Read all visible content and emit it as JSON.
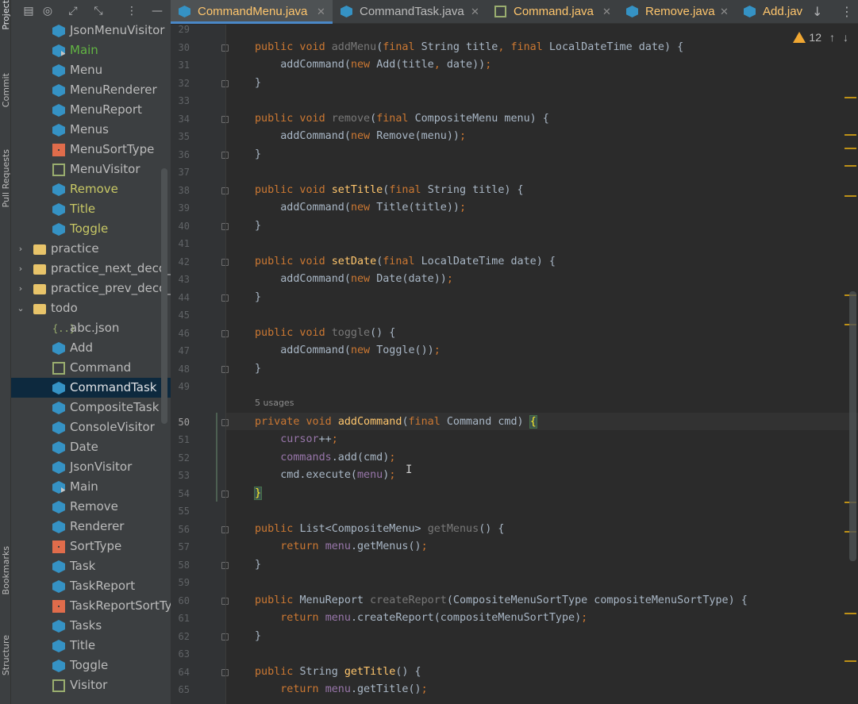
{
  "side_strip": {
    "project": "Project",
    "commit": "Commit",
    "pull_requests": "Pull Requests",
    "bookmarks": "Bookmarks",
    "structure": "Structure"
  },
  "tree": [
    {
      "label": "JsonMenuVisitor",
      "icon": "class-icon",
      "style": ""
    },
    {
      "label": "Main",
      "icon": "run-class-icon",
      "style": "green"
    },
    {
      "label": "Menu",
      "icon": "class-icon",
      "style": ""
    },
    {
      "label": "MenuRenderer",
      "icon": "class-icon",
      "style": ""
    },
    {
      "label": "MenuReport",
      "icon": "class-icon",
      "style": ""
    },
    {
      "label": "Menus",
      "icon": "class-icon",
      "style": ""
    },
    {
      "label": "MenuSortType",
      "icon": "enum-icon",
      "style": ""
    },
    {
      "label": "MenuVisitor",
      "icon": "interface-icon",
      "style": ""
    },
    {
      "label": "Remove",
      "icon": "class-icon",
      "style": "green2"
    },
    {
      "label": "Title",
      "icon": "class-icon",
      "style": "green2"
    },
    {
      "label": "Toggle",
      "icon": "class-icon",
      "style": "green2"
    },
    {
      "label": "practice",
      "icon": "folder-icon",
      "style": "",
      "chev": "›",
      "indent": 1
    },
    {
      "label": "practice_next_deco_fo",
      "icon": "folder-icon",
      "style": "",
      "chev": "›",
      "indent": 1
    },
    {
      "label": "practice_prev_deco_fo",
      "icon": "folder-icon",
      "style": "",
      "chev": "›",
      "indent": 1
    },
    {
      "label": "todo",
      "icon": "folder-icon",
      "style": "",
      "chev": "⌄",
      "indent": 1
    },
    {
      "label": "abc.json",
      "icon": "json-icon",
      "style": ""
    },
    {
      "label": "Add",
      "icon": "class-icon",
      "style": ""
    },
    {
      "label": "Command",
      "icon": "interface-icon",
      "style": ""
    },
    {
      "label": "CommandTask",
      "icon": "class-icon",
      "style": "selected"
    },
    {
      "label": "CompositeTask",
      "icon": "class-icon",
      "style": ""
    },
    {
      "label": "ConsoleVisitor",
      "icon": "class-icon",
      "style": ""
    },
    {
      "label": "Date",
      "icon": "class-icon",
      "style": ""
    },
    {
      "label": "JsonVisitor",
      "icon": "class-icon",
      "style": ""
    },
    {
      "label": "Main",
      "icon": "run-class-icon",
      "style": ""
    },
    {
      "label": "Remove",
      "icon": "class-icon",
      "style": ""
    },
    {
      "label": "Renderer",
      "icon": "class-icon",
      "style": ""
    },
    {
      "label": "SortType",
      "icon": "enum-icon",
      "style": ""
    },
    {
      "label": "Task",
      "icon": "class-icon",
      "style": ""
    },
    {
      "label": "TaskReport",
      "icon": "class-icon",
      "style": ""
    },
    {
      "label": "TaskReportSortTyp",
      "icon": "enum-icon",
      "style": ""
    },
    {
      "label": "Tasks",
      "icon": "class-icon",
      "style": ""
    },
    {
      "label": "Title",
      "icon": "class-icon",
      "style": ""
    },
    {
      "label": "Toggle",
      "icon": "class-icon",
      "style": ""
    },
    {
      "label": "Visitor",
      "icon": "interface-icon",
      "style": ""
    }
  ],
  "tabs": [
    {
      "label": "CommandMenu.java",
      "icon": "class-icon",
      "active": true,
      "color": "#ffc66d"
    },
    {
      "label": "CommandTask.java",
      "icon": "class-icon",
      "active": false,
      "color": "#bbbbbb"
    },
    {
      "label": "Command.java",
      "icon": "interface-icon",
      "active": false,
      "color": "#ffc66d"
    },
    {
      "label": "Remove.java",
      "icon": "class-icon",
      "active": false,
      "color": "#ffc66d"
    },
    {
      "label": "Add.jav",
      "icon": "class-icon",
      "active": false,
      "color": "#ffc66d"
    }
  ],
  "warnings": {
    "count": "12"
  },
  "usages_hint": "5 usages",
  "lines": [
    {
      "n": "29",
      "html": ""
    },
    {
      "n": "30",
      "html": "<span class='kw'>public void </span><span class='fnu'>addMenu</span>(<span class='kw'>final </span>String title<span class='kw'>, final </span>LocalDateTime date) {"
    },
    {
      "n": "31",
      "html": "    addCommand(<span class='kw'>new </span>Add(title<span class='kw'>, </span>date))<span class='kw'>;</span>"
    },
    {
      "n": "32",
      "html": "}"
    },
    {
      "n": "33",
      "html": ""
    },
    {
      "n": "34",
      "html": "<span class='kw'>public void </span><span class='fnu'>remove</span>(<span class='kw'>final </span>CompositeMenu menu) {"
    },
    {
      "n": "35",
      "html": "    addCommand(<span class='kw'>new </span>Remove(menu))<span class='kw'>;</span>"
    },
    {
      "n": "36",
      "html": "}"
    },
    {
      "n": "37",
      "html": ""
    },
    {
      "n": "38",
      "html": "<span class='kw'>public void </span><span class='fn'>setTitle</span>(<span class='kw'>final </span>String title) {"
    },
    {
      "n": "39",
      "html": "    addCommand(<span class='kw'>new </span>Title(title))<span class='kw'>;</span>"
    },
    {
      "n": "40",
      "html": "}"
    },
    {
      "n": "41",
      "html": ""
    },
    {
      "n": "42",
      "html": "<span class='kw'>public void </span><span class='fn'>setDate</span>(<span class='kw'>final </span>LocalDateTime date) {"
    },
    {
      "n": "43",
      "html": "    addCommand(<span class='kw'>new </span>Date(date))<span class='kw'>;</span>"
    },
    {
      "n": "44",
      "html": "}"
    },
    {
      "n": "45",
      "html": ""
    },
    {
      "n": "46",
      "html": "<span class='kw'>public void </span><span class='fnu'>toggle</span>() {"
    },
    {
      "n": "47",
      "html": "    addCommand(<span class='kw'>new </span>Toggle())<span class='kw'>;</span>"
    },
    {
      "n": "48",
      "html": "}"
    },
    {
      "n": "49",
      "html": ""
    },
    {
      "n": "50",
      "html": "<span class='kw'>private void </span><span class='fn'>addCommand</span>(<span class='kw'>final </span>Command cmd) <span class='brace-match'>{</span>"
    },
    {
      "n": "51",
      "html": "    <span class='fld'>cursor</span>++<span class='kw'>;</span>"
    },
    {
      "n": "52",
      "html": "    <span class='fld'>commands</span>.add(cmd)<span class='kw'>;</span>"
    },
    {
      "n": "53",
      "html": "    cmd.execute(<span class='fld'>menu</span>)<span class='kw'>;</span>"
    },
    {
      "n": "54",
      "html": "<span class='brace-match'>}</span>"
    },
    {
      "n": "55",
      "html": ""
    },
    {
      "n": "56",
      "html": "<span class='kw'>public </span>List&lt;CompositeMenu&gt; <span class='fnu'>getMenus</span>() {"
    },
    {
      "n": "57",
      "html": "    <span class='kw'>return </span><span class='fld'>menu</span>.getMenus()<span class='kw'>;</span>"
    },
    {
      "n": "58",
      "html": "}"
    },
    {
      "n": "59",
      "html": ""
    },
    {
      "n": "60",
      "html": "<span class='kw'>public </span>MenuReport <span class='fnu'>createReport</span>(CompositeMenuSortType compositeMenuSortType) {"
    },
    {
      "n": "61",
      "html": "    <span class='kw'>return </span><span class='fld'>menu</span>.createReport(compositeMenuSortType)<span class='kw'>;</span>"
    },
    {
      "n": "62",
      "html": "}"
    },
    {
      "n": "63",
      "html": ""
    },
    {
      "n": "64",
      "html": "<span class='kw'>public </span>String <span class='fn'>getTitle</span>() {"
    },
    {
      "n": "65",
      "html": "    <span class='kw'>return </span><span class='fld'>menu</span>.getTitle()<span class='kw'>;</span>"
    }
  ]
}
